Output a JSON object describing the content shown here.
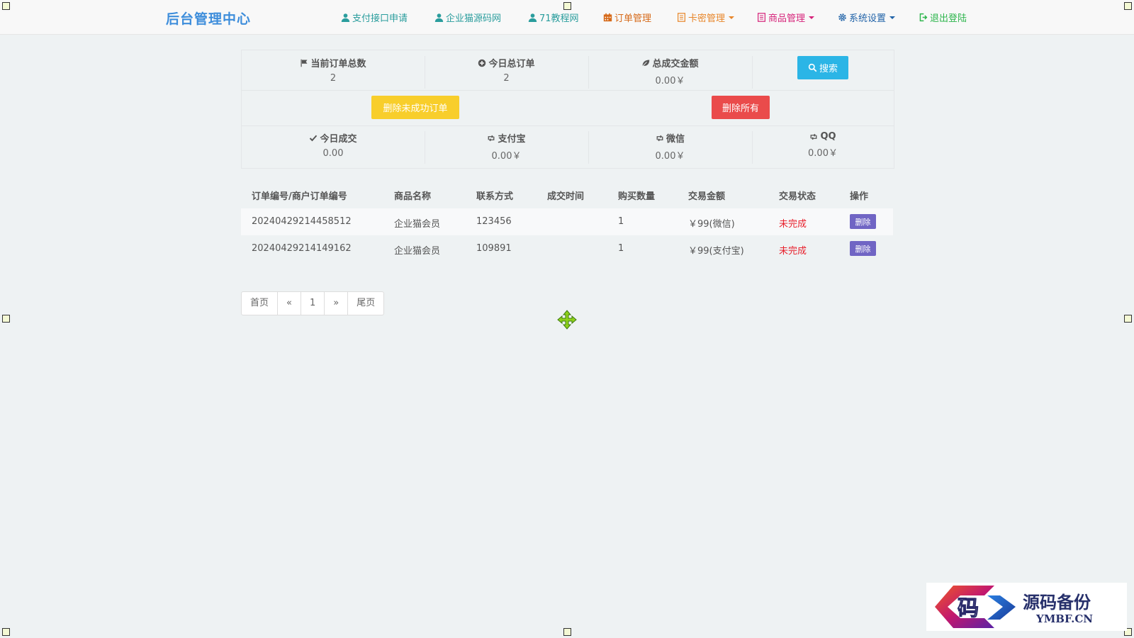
{
  "brand": "后台管理中心",
  "nav": [
    {
      "label": "支付接口申请",
      "icon": "user-icon",
      "color": "#2a9d9d",
      "dropdown": false
    },
    {
      "label": "企业猫源码网",
      "icon": "user-icon",
      "color": "#2a9d9d",
      "dropdown": false
    },
    {
      "label": "71教程网",
      "icon": "user-icon",
      "color": "#2a9d9d",
      "dropdown": false
    },
    {
      "label": "订单管理",
      "icon": "calendar-icon",
      "color": "#d66a1a",
      "dropdown": false
    },
    {
      "label": "卡密管理",
      "icon": "list-icon",
      "color": "#e8862a",
      "dropdown": true
    },
    {
      "label": "商品管理",
      "icon": "list-icon",
      "color": "#d6237a",
      "dropdown": true
    },
    {
      "label": "系统设置",
      "icon": "gear-icon",
      "color": "#2163a8",
      "dropdown": true
    },
    {
      "label": "退出登陆",
      "icon": "logout-icon",
      "color": "#2db54c",
      "dropdown": false
    }
  ],
  "stats": {
    "total_orders_label": "当前订单总数",
    "total_orders_value": "2",
    "today_orders_label": "今日总订单",
    "today_orders_value": "2",
    "total_amount_label": "总成交金额",
    "total_amount_value": "0.00￥",
    "search_label": "搜索",
    "delete_failed_label": "删除未成功订单",
    "delete_all_label": "删除所有",
    "today_deal_label": "今日成交",
    "today_deal_value": "0.00",
    "alipay_label": "支付宝",
    "alipay_value": "0.00￥",
    "wechat_label": "微信",
    "wechat_value": "0.00￥",
    "qq_label": "QQ",
    "qq_value": "0.00￥"
  },
  "table": {
    "headers": [
      "订单编号/商户订单编号",
      "商品名称",
      "联系方式",
      "成交时间",
      "购买数量",
      "交易金额",
      "交易状态",
      "操作"
    ],
    "rows": [
      {
        "order_no": "20240429214458512",
        "product": "企业猫会员",
        "contact": "123456",
        "time": "",
        "qty": "1",
        "amount": "￥99(微信)",
        "status": "未完成",
        "action": "删除"
      },
      {
        "order_no": "20240429214149162",
        "product": "企业猫会员",
        "contact": "109891",
        "time": "",
        "qty": "1",
        "amount": "￥99(支付宝)",
        "status": "未完成",
        "action": "删除"
      }
    ]
  },
  "pager": {
    "first": "首页",
    "prev": "«",
    "current": "1",
    "next": "»",
    "last": "尾页"
  },
  "watermark": {
    "title": "源码备份",
    "site": "YMBF.CN",
    "logo_char": "码"
  }
}
